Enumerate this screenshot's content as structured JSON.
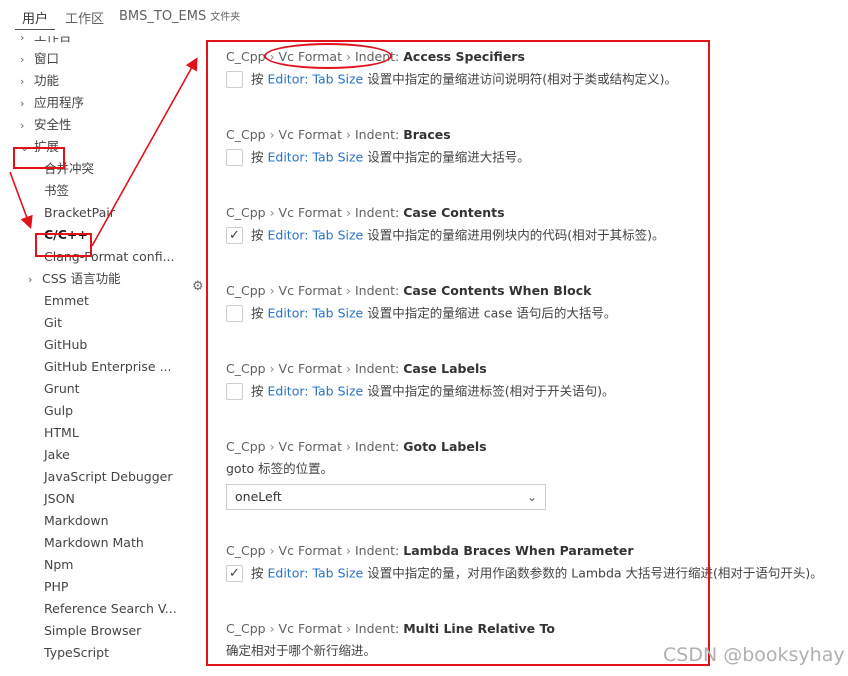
{
  "scope_tabs": {
    "user": "用户",
    "workspace": "工作区",
    "folder": "BMS_TO_EMS",
    "folder_sub": "文件夹"
  },
  "sidebar": {
    "items": [
      {
        "label": "工作台",
        "chevron": "›"
      },
      {
        "label": "窗口",
        "chevron": "›"
      },
      {
        "label": "功能",
        "chevron": "›"
      },
      {
        "label": "应用程序",
        "chevron": "›"
      },
      {
        "label": "安全性",
        "chevron": "›"
      },
      {
        "label": "扩展",
        "chevron": "⌄"
      },
      {
        "label": "合并冲突"
      },
      {
        "label": "书签"
      },
      {
        "label": "BracketPair"
      },
      {
        "label": "C/C++"
      },
      {
        "label": "Clang-Format confi..."
      },
      {
        "label": "CSS 语言功能",
        "chevron": "›"
      },
      {
        "label": "Emmet"
      },
      {
        "label": "Git"
      },
      {
        "label": "GitHub"
      },
      {
        "label": "GitHub Enterprise ..."
      },
      {
        "label": "Grunt"
      },
      {
        "label": "Gulp"
      },
      {
        "label": "HTML"
      },
      {
        "label": "Jake"
      },
      {
        "label": "JavaScript Debugger"
      },
      {
        "label": "JSON"
      },
      {
        "label": "Markdown"
      },
      {
        "label": "Markdown Math"
      },
      {
        "label": "Npm"
      },
      {
        "label": "PHP"
      },
      {
        "label": "Reference Search V..."
      },
      {
        "label": "Simple Browser"
      },
      {
        "label": "TypeScript"
      }
    ]
  },
  "settings": {
    "prefix": "C_Cpp",
    "group": "Vc Format",
    "sub": "Indent:",
    "sep": "›",
    "link": "Editor: Tab Size",
    "link_pre": "按",
    "items": [
      {
        "name": "Access Specifiers",
        "desc": "设置中指定的量缩进访问说明符(相对于类或结构定义)。",
        "checked": false,
        "check_glyph": ""
      },
      {
        "name": "Braces",
        "desc": "设置中指定的量缩进大括号。",
        "checked": false,
        "check_glyph": ""
      },
      {
        "name": "Case Contents",
        "desc": "设置中指定的量缩进用例块内的代码(相对于其标签)。",
        "checked": true,
        "check_glyph": "✓"
      },
      {
        "name": "Case Contents When Block",
        "desc": "设置中指定的量缩进 case 语句后的大括号。",
        "checked": false,
        "check_glyph": ""
      },
      {
        "name": "Case Labels",
        "desc": "设置中指定的量缩进标签(相对于开关语句)。",
        "checked": false,
        "check_glyph": ""
      },
      {
        "name": "Goto Labels",
        "plain_desc": "goto 标签的位置。",
        "select_value": "oneLeft"
      },
      {
        "name": "Lambda Braces When Parameter",
        "desc": "设置中指定的量，对用作函数参数的 Lambda 大括号进行缩进(相对于语句开头)。",
        "checked": true,
        "check_glyph": "✓"
      },
      {
        "name": "Multi Line Relative To",
        "plain_desc": "确定相对于哪个新行缩进。"
      }
    ]
  },
  "icons": {
    "gear": "⚙",
    "chevron_down": "⌄"
  },
  "colors": {
    "annotation_red": "#e0121a",
    "link_blue": "#2672c8"
  },
  "watermark": "CSDN @booksyhay"
}
